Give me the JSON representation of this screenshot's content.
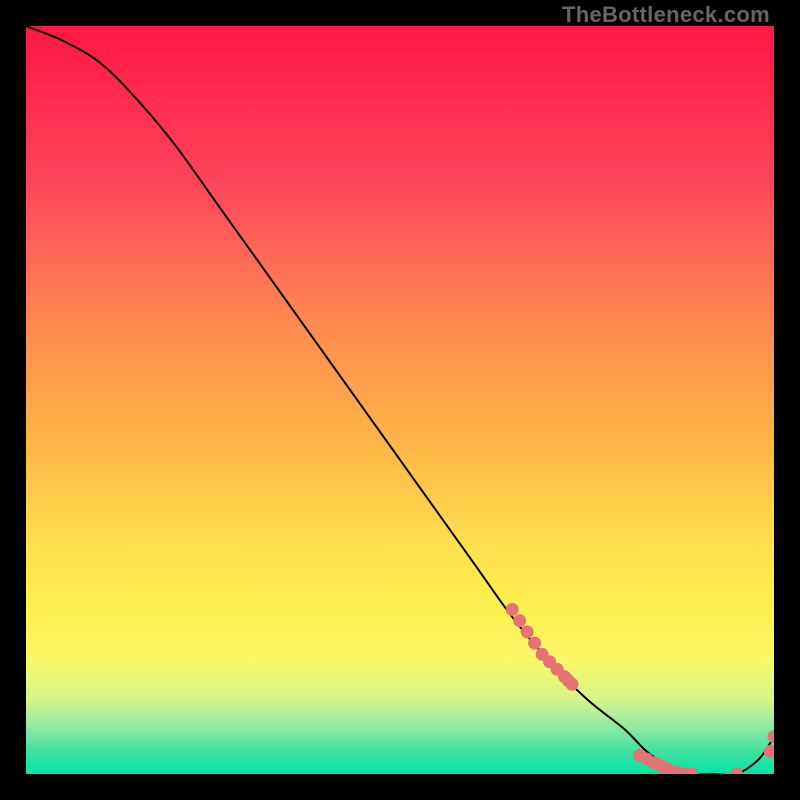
{
  "watermark": "TheBottleneck.com",
  "chart_data": {
    "type": "line",
    "title": "",
    "xlabel": "",
    "ylabel": "",
    "xlim": [
      0,
      100
    ],
    "ylim": [
      0,
      100
    ],
    "grid": false,
    "legend": false,
    "series": [
      {
        "name": "bottleneck-curve",
        "color": "#000000",
        "x": [
          0,
          5,
          10,
          15,
          20,
          25,
          30,
          35,
          40,
          45,
          50,
          55,
          60,
          65,
          70,
          75,
          80,
          83,
          86,
          89,
          92,
          95,
          98,
          100
        ],
        "y": [
          100,
          98,
          95,
          90,
          84,
          77,
          70,
          63,
          56,
          49,
          42,
          35,
          28,
          21,
          15,
          10,
          6,
          3,
          1,
          0,
          0,
          0,
          2,
          5
        ]
      }
    ],
    "scatter_points": {
      "name": "highlighted-points",
      "color": "#e57373",
      "x": [
        65,
        66,
        67,
        68,
        69,
        70,
        71,
        72,
        72.5,
        73,
        82,
        83,
        84,
        85,
        85.5,
        86,
        86.5,
        87,
        87.5,
        88,
        88.5,
        89,
        95,
        99.5,
        100
      ],
      "y": [
        22,
        20.5,
        19,
        17.5,
        16,
        15,
        14,
        13,
        12.5,
        12,
        2.5,
        2,
        1.5,
        1,
        0.8,
        0.5,
        0.3,
        0.2,
        0.1,
        0,
        0,
        0,
        0,
        3,
        5
      ]
    },
    "background_gradient": {
      "stops": [
        {
          "pos": 0.0,
          "color": "#ff1744"
        },
        {
          "pos": 0.2,
          "color": "#ff425a"
        },
        {
          "pos": 0.4,
          "color": "#ff8a50"
        },
        {
          "pos": 0.55,
          "color": "#ffb347"
        },
        {
          "pos": 0.7,
          "color": "#ffe14d"
        },
        {
          "pos": 0.78,
          "color": "#fff04d"
        },
        {
          "pos": 0.85,
          "color": "#f8f86a"
        },
        {
          "pos": 0.9,
          "color": "#d4f58a"
        },
        {
          "pos": 0.94,
          "color": "#8ae9a5"
        },
        {
          "pos": 0.97,
          "color": "#3fe0a0"
        },
        {
          "pos": 1.0,
          "color": "#00e5a8"
        }
      ]
    }
  }
}
